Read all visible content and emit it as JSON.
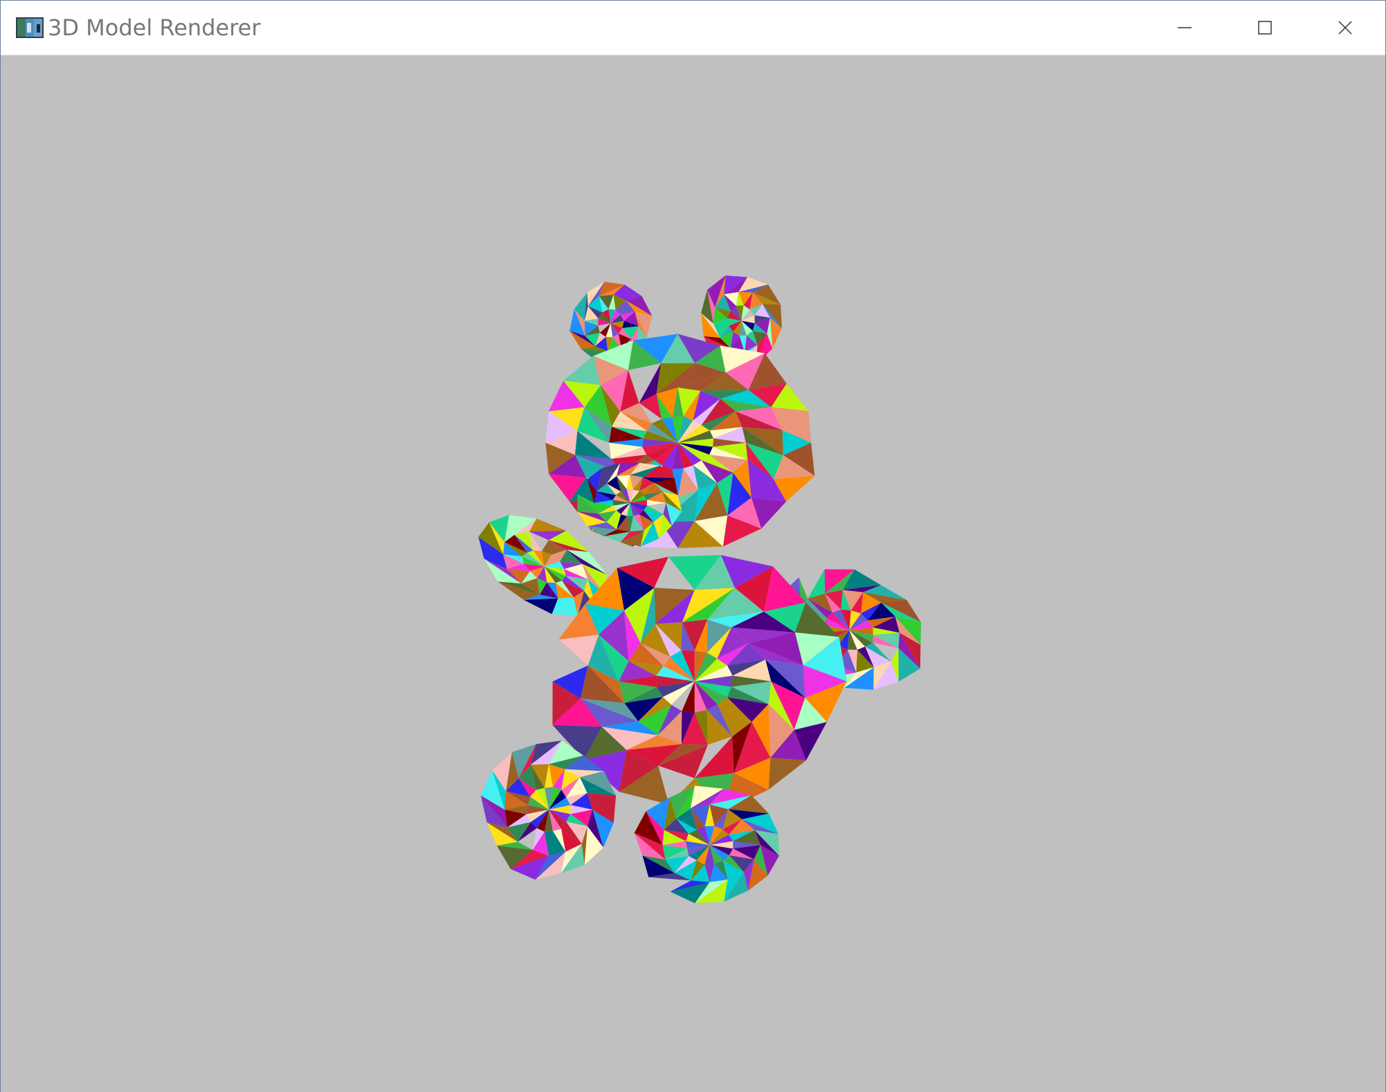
{
  "window": {
    "title": "3D Model Renderer",
    "controls": {
      "minimize": "minimize-icon",
      "maximize": "maximize-icon",
      "close": "close-icon"
    }
  },
  "viewport": {
    "background_color": "#bfc0bf",
    "model": "teddy-bear",
    "shading": "random-flat-color-per-triangle"
  }
}
